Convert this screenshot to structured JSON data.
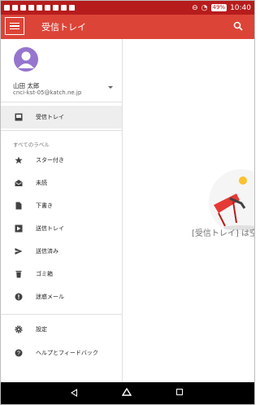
{
  "status_bar": {
    "time": "10:40",
    "battery": "49%"
  },
  "app_bar": {
    "title": "受信トレイ"
  },
  "account": {
    "name": "山田 太郎",
    "email": "cnci-kst-05@katch.ne.jp"
  },
  "drawer": {
    "inbox_label": "受信トレイ",
    "section_label": "すべてのラベル",
    "labels": [
      {
        "label": "スター付き",
        "icon": "star-icon"
      },
      {
        "label": "未読",
        "icon": "unread-envelope-icon"
      },
      {
        "label": "下書き",
        "icon": "draft-document-icon"
      },
      {
        "label": "送信トレイ",
        "icon": "outbox-icon"
      },
      {
        "label": "送信済み",
        "icon": "send-icon"
      },
      {
        "label": "ゴミ箱",
        "icon": "trash-icon"
      },
      {
        "label": "迷惑メール",
        "icon": "spam-icon"
      }
    ],
    "settings_label": "設定",
    "help_label": "ヘルプとフィードバック"
  },
  "content": {
    "empty_text": "[受信トレイ] は空"
  },
  "colors": {
    "app_bar": "#db4437",
    "status_bar": "#b71c1c",
    "avatar": "#9575cd"
  }
}
